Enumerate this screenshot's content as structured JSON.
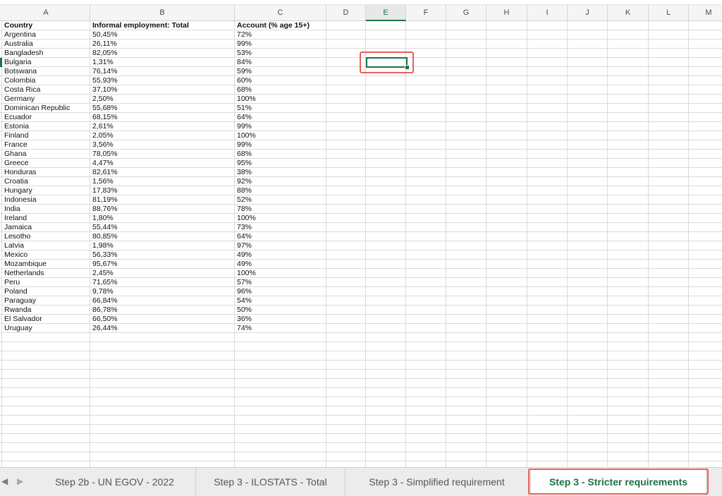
{
  "colors": {
    "accent": "#1e7145",
    "highlight": "#e9605a"
  },
  "columns": [
    "A",
    "B",
    "C",
    "D",
    "E",
    "F",
    "G",
    "H",
    "I",
    "J",
    "K",
    "L",
    "M"
  ],
  "selected_column": "E",
  "headers": {
    "country": "Country",
    "informal": "Informal employment: Total",
    "account": "Account (% age 15+)"
  },
  "rows": [
    {
      "country": "Argentina",
      "informal": "50,45%",
      "account": "72%"
    },
    {
      "country": "Australia",
      "informal": "26,11%",
      "account": "99%"
    },
    {
      "country": "Bangladesh",
      "informal": "82,05%",
      "account": "53%"
    },
    {
      "country": "Bulgaria",
      "informal": "1,31%",
      "account": "84%"
    },
    {
      "country": "Botswana",
      "informal": "76,14%",
      "account": "59%"
    },
    {
      "country": "Colombia",
      "informal": "55,93%",
      "account": "60%"
    },
    {
      "country": "Costa Rica",
      "informal": "37,10%",
      "account": "68%"
    },
    {
      "country": "Germany",
      "informal": "2,50%",
      "account": "100%"
    },
    {
      "country": "Dominican Republic",
      "informal": "55,68%",
      "account": "51%"
    },
    {
      "country": "Ecuador",
      "informal": "68,15%",
      "account": "64%"
    },
    {
      "country": "Estonia",
      "informal": "2,61%",
      "account": "99%"
    },
    {
      "country": "Finland",
      "informal": "2,05%",
      "account": "100%"
    },
    {
      "country": "France",
      "informal": "3,56%",
      "account": "99%"
    },
    {
      "country": "Ghana",
      "informal": "78,05%",
      "account": "68%"
    },
    {
      "country": "Greece",
      "informal": "4,47%",
      "account": "95%"
    },
    {
      "country": "Honduras",
      "informal": "82,61%",
      "account": "38%"
    },
    {
      "country": "Croatia",
      "informal": "1,56%",
      "account": "92%"
    },
    {
      "country": "Hungary",
      "informal": "17,83%",
      "account": "88%"
    },
    {
      "country": "Indonesia",
      "informal": "81,19%",
      "account": "52%"
    },
    {
      "country": "India",
      "informal": "88,76%",
      "account": "78%"
    },
    {
      "country": "Ireland",
      "informal": "1,80%",
      "account": "100%"
    },
    {
      "country": "Jamaica",
      "informal": "55,44%",
      "account": "73%"
    },
    {
      "country": "Lesotho",
      "informal": "80,85%",
      "account": "64%"
    },
    {
      "country": "Latvia",
      "informal": "1,98%",
      "account": "97%"
    },
    {
      "country": "Mexico",
      "informal": "56,33%",
      "account": "49%"
    },
    {
      "country": "Mozambique",
      "informal": "95,67%",
      "account": "49%"
    },
    {
      "country": "Netherlands",
      "informal": "2,45%",
      "account": "100%"
    },
    {
      "country": "Peru",
      "informal": "71,65%",
      "account": "57%"
    },
    {
      "country": "Poland",
      "informal": "9,78%",
      "account": "96%"
    },
    {
      "country": "Paraguay",
      "informal": "66,84%",
      "account": "54%"
    },
    {
      "country": "Rwanda",
      "informal": "86,78%",
      "account": "50%"
    },
    {
      "country": "El Salvador",
      "informal": "66,50%",
      "account": "36%"
    },
    {
      "country": "Uruguay",
      "informal": "26,44%",
      "account": "74%"
    }
  ],
  "sheet_tabs": [
    {
      "label": "Step 2b - UN EGOV - 2022"
    },
    {
      "label": "Step 3 - ILOSTATS - Total"
    },
    {
      "label": "Step 3 - Simplified requirement"
    },
    {
      "label": "Step 3 - Stricter requirements",
      "active": true
    }
  ],
  "icons": {
    "prev": "triangle-left",
    "next": "triangle-right"
  },
  "nav": {
    "prev_glyph": "◀",
    "next_glyph": "▶"
  }
}
